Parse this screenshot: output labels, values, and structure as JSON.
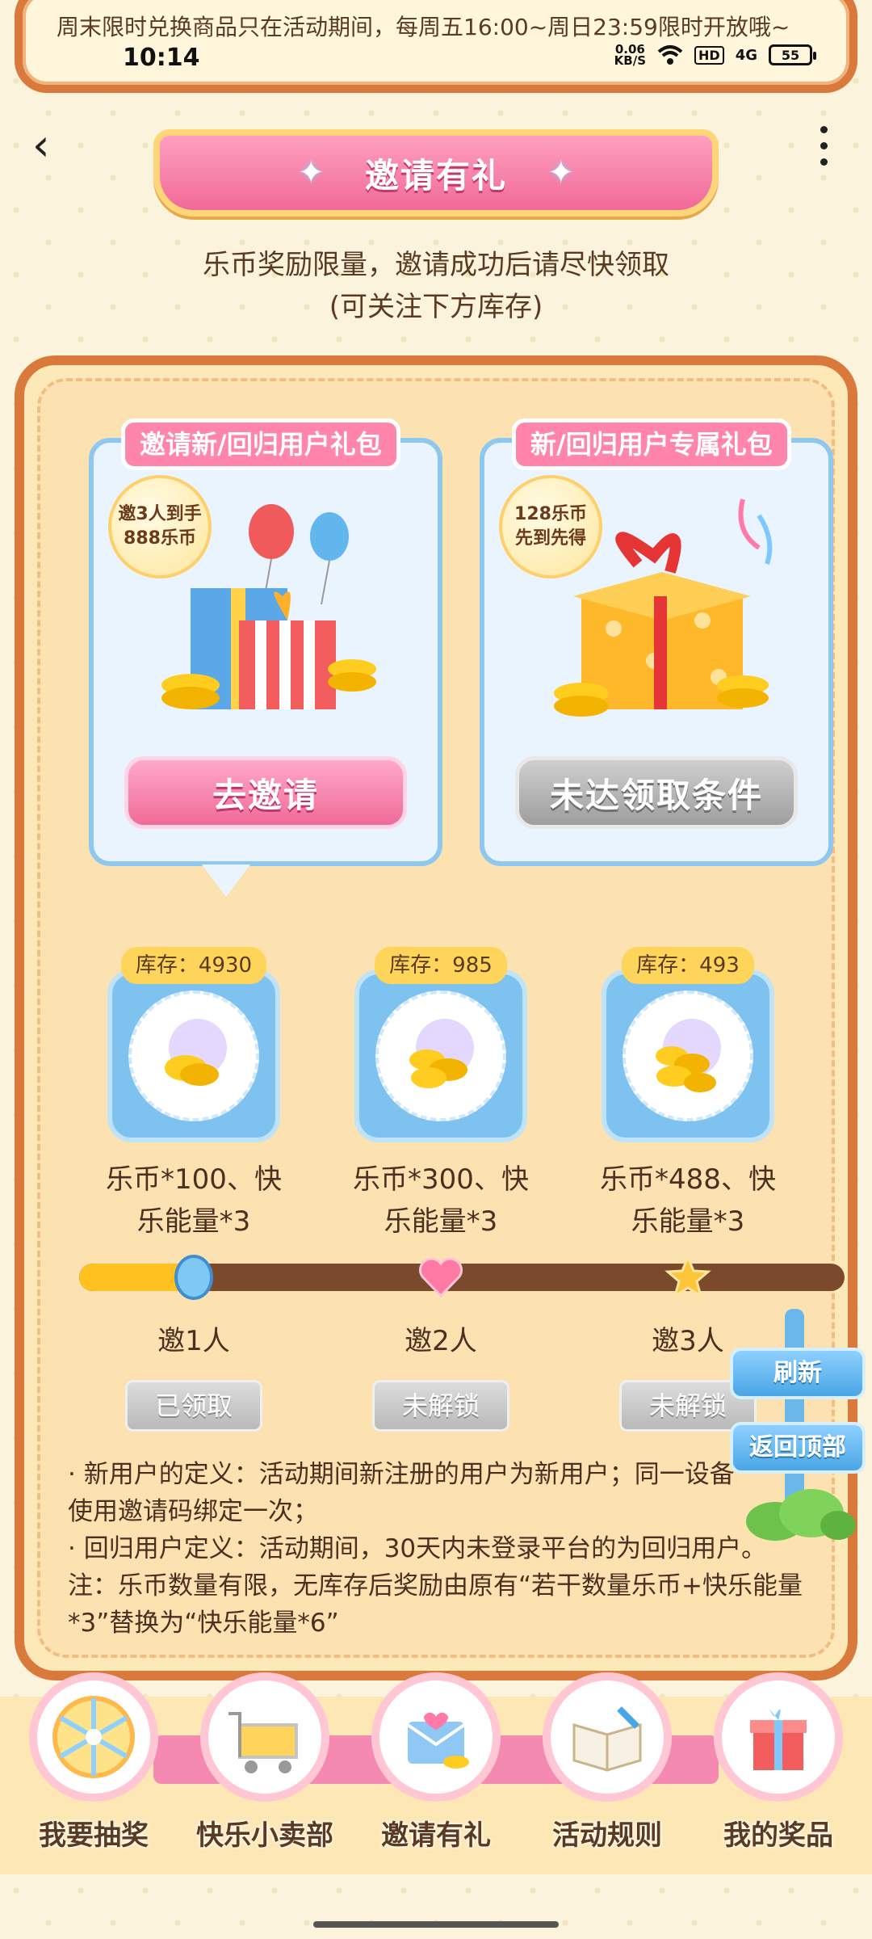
{
  "top_banner": {
    "text": "周末限时兑换商品只在活动期间，每周五16:00~周日23:59限时开放哦~"
  },
  "status_bar": {
    "time": "10:14",
    "speed": "0.06",
    "speed_unit": "KB/S",
    "hd": "HD",
    "net": "4G",
    "battery": "55"
  },
  "header": {
    "title": "邀请有礼"
  },
  "subtitle": {
    "line1": "乐币奖励限量，邀请成功后请尽快领取",
    "line2": "(可关注下方库存)"
  },
  "cards": [
    {
      "tag": "邀请新/回归用户礼包",
      "bubble_line1": "邀3人到手",
      "bubble_line2": "888乐币",
      "button": "去邀请"
    },
    {
      "tag": "新/回归用户专属礼包",
      "bubble_line1": "128乐币",
      "bubble_line2": "先到先得",
      "button": "未达领取条件"
    }
  ],
  "rewards": [
    {
      "stock": "库存：4930",
      "line1": "乐币*100、快",
      "line2": "乐能量*3",
      "step": "邀1人",
      "status": "已领取"
    },
    {
      "stock": "库存：985",
      "line1": "乐币*300、快",
      "line2": "乐能量*3",
      "step": "邀2人",
      "status": "未解锁"
    },
    {
      "stock": "库存：493",
      "line1": "乐币*488、快",
      "line2": "乐能量*3",
      "step": "邀3人",
      "status": "未解锁"
    }
  ],
  "progress": {
    "fraction": 0.17
  },
  "notes": [
    "· 新用户的定义：活动期间新注册的用户为新用户；同一设备",
    "使用邀请码绑定一次；",
    "· 回归用户定义：活动期间，30天内未登录平台的为回归用户。",
    "注：乐币数量有限，无库存后奖励由原有“若干数量乐币+快乐能量",
    "*3”替换为“快乐能量*6”"
  ],
  "side_buttons": {
    "refresh": "刷新",
    "back_top": "返回顶部"
  },
  "bottom_nav": [
    {
      "label": "我要抽奖",
      "icon": "wheel-icon"
    },
    {
      "label": "快乐小卖部",
      "icon": "cart-icon"
    },
    {
      "label": "邀请有礼",
      "icon": "invite-envelope-icon"
    },
    {
      "label": "活动规则",
      "icon": "rules-book-icon"
    },
    {
      "label": "我的奖品",
      "icon": "gift-box-icon"
    }
  ],
  "colors": {
    "pink": "#f06a98",
    "orange_border": "#d97a3c",
    "blue": "#7ec2f0",
    "gold": "#ffc11f"
  }
}
